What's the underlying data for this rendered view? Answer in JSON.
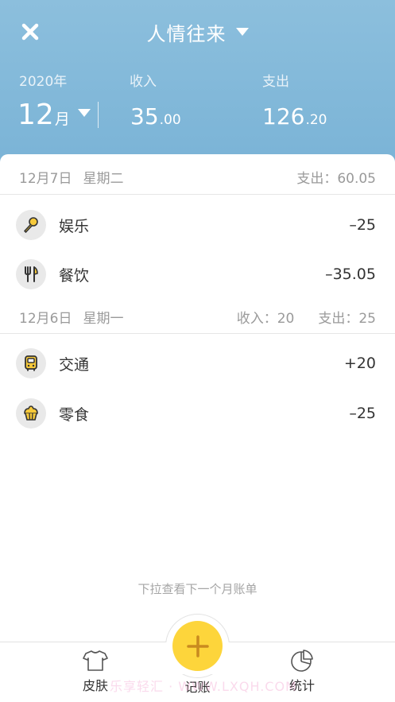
{
  "header": {
    "title": "人情往来",
    "year": "2020年",
    "month_num": "12",
    "month_unit": "月",
    "income_label": "收入",
    "expense_label": "支出",
    "income_int": "35",
    "income_dec": ".00",
    "expense_int": "126",
    "expense_dec": ".20",
    "bg_color": "#84b9da"
  },
  "days": [
    {
      "date": "12月7日",
      "weekday": "星期二",
      "income_summary": "",
      "expense_summary": "支出：60.05",
      "items": [
        {
          "name": "娱乐",
          "amount": "–25",
          "icon": "microphone-icon"
        },
        {
          "name": "餐饮",
          "amount": "–35.05",
          "icon": "fork-knife-icon"
        }
      ]
    },
    {
      "date": "12月6日",
      "weekday": "星期一",
      "income_summary": "收入：20",
      "expense_summary": "支出：25",
      "items": [
        {
          "name": "交通",
          "amount": "+20",
          "icon": "bus-icon"
        },
        {
          "name": "零食",
          "amount": "–25",
          "icon": "cake-icon"
        }
      ]
    }
  ],
  "hint": "下拉查看下一个月账单",
  "tabbar": {
    "skin_label": "皮肤",
    "record_label": "记账",
    "stats_label": "统计",
    "accent": "#fdd53b"
  },
  "watermark": "乐享轻汇 · WWW.LXQH.COM"
}
